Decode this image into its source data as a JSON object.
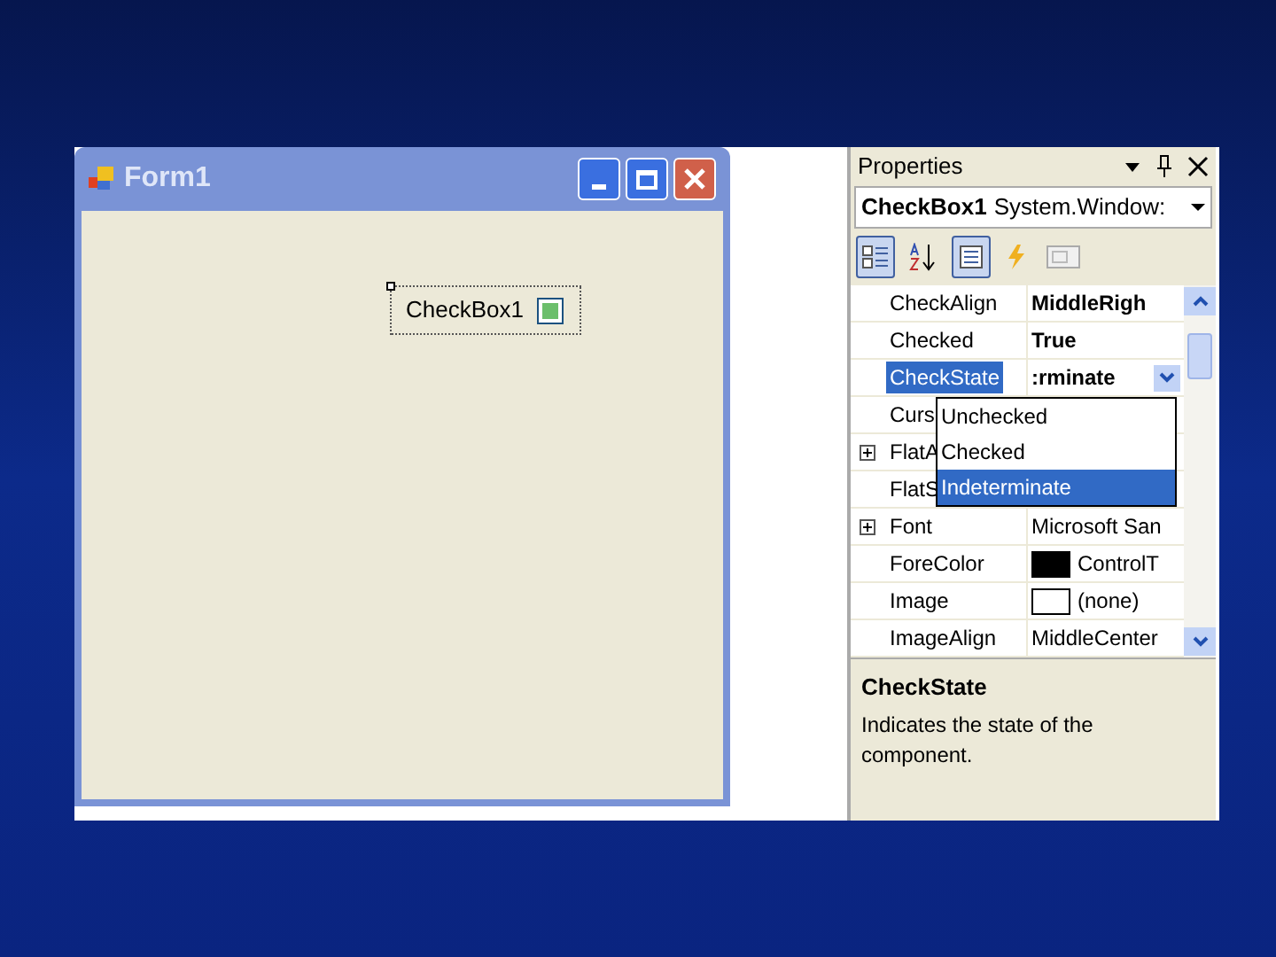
{
  "form": {
    "title": "Form1",
    "checkbox": {
      "label": "CheckBox1",
      "indeterminate": true
    }
  },
  "properties": {
    "title": "Properties",
    "object_name": "CheckBox1",
    "object_type": "System.Window:",
    "toolbar": [
      {
        "kind": "categorized",
        "selected": true
      },
      {
        "kind": "alphabetical",
        "selected": false
      },
      {
        "kind": "properties",
        "selected": true
      },
      {
        "kind": "events",
        "selected": false
      },
      {
        "kind": "pages",
        "selected": false
      }
    ],
    "rows": [
      {
        "name": "CheckAlign",
        "value": "MiddleRigh",
        "bold": true,
        "selected": false,
        "expandable": false,
        "kind": "text"
      },
      {
        "name": "Checked",
        "value": "True",
        "bold": true,
        "selected": false,
        "expandable": false,
        "kind": "text"
      },
      {
        "name": "CheckState",
        "value": ":rminate",
        "bold": true,
        "selected": true,
        "expandable": false,
        "kind": "dropdown"
      },
      {
        "name": "Curs",
        "selected": false,
        "expandable": false,
        "kind": "hidden"
      },
      {
        "name": "FlatA",
        "selected": false,
        "expandable": true,
        "kind": "hidden"
      },
      {
        "name": "FlatS",
        "selected": false,
        "expandable": false,
        "kind": "hidden"
      },
      {
        "name": "Font",
        "value": "Microsoft San",
        "bold": false,
        "selected": false,
        "expandable": true,
        "kind": "text"
      },
      {
        "name": "ForeColor",
        "value": "ControlT",
        "bold": false,
        "selected": false,
        "expandable": false,
        "kind": "swatch",
        "color": "#000000"
      },
      {
        "name": "Image",
        "value": "(none)",
        "bold": false,
        "selected": false,
        "expandable": false,
        "kind": "swatch",
        "color": "#ffffff"
      },
      {
        "name": "ImageAlign",
        "value": "MiddleCenter",
        "bold": false,
        "selected": false,
        "expandable": false,
        "kind": "text"
      }
    ],
    "dropdown_options": [
      {
        "label": "Unchecked",
        "selected": false
      },
      {
        "label": "Checked",
        "selected": false
      },
      {
        "label": "Indeterminate",
        "selected": true
      }
    ],
    "description": {
      "title": "CheckState",
      "text": "Indicates the state of the component."
    }
  }
}
